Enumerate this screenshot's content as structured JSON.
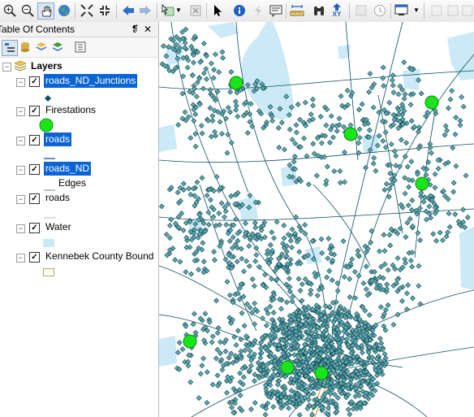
{
  "toolbar": {
    "icons": [
      "zoom-in-icon",
      "zoom-out-icon",
      "pan-hand-icon",
      "full-extent-globe-icon",
      "fixed-zoom-in-icon",
      "fixed-zoom-out-icon",
      "back-arrow-icon",
      "forward-arrow-icon",
      "select-features-icon",
      "clear-selection-icon",
      "select-elements-arrow-icon",
      "identify-info-icon",
      "hyperlink-lightning-icon",
      "html-popup-icon",
      "measure-ruler-icon",
      "find-binoculars-icon",
      "go-to-xy-icon",
      "time-slider-icon",
      "create-viewer-window-icon"
    ],
    "goto_xy_text": "XY"
  },
  "toc": {
    "title": "Table Of Contents",
    "pin_glyph": "❡",
    "close_glyph": "✕",
    "root_label": "Layers",
    "layers": [
      {
        "name": "roads_ND_Junctions",
        "selected": true,
        "symbol": "point",
        "legend": ""
      },
      {
        "name": "Firestations",
        "selected": false,
        "symbol": "green-circle",
        "legend": ""
      },
      {
        "name": "roads",
        "selected": true,
        "symbol": "blue-line",
        "legend": ""
      },
      {
        "name": "roads_ND",
        "selected": true,
        "symbol": "edge-line",
        "legend": "Edges"
      },
      {
        "name": "roads",
        "selected": false,
        "symbol": "grey-line",
        "legend": ""
      },
      {
        "name": "Water",
        "selected": false,
        "symbol": "water-box",
        "legend": ""
      },
      {
        "name": "Kennebek County Bound",
        "selected": false,
        "symbol": "boundary-box",
        "legend": ""
      }
    ]
  },
  "colors": {
    "selection": "#0a64d3",
    "water": "#cce9f7",
    "road": "#0b4f5f",
    "junction": "#5eaab0",
    "firestation": "#19e619",
    "boundary": "#b8a84a"
  }
}
